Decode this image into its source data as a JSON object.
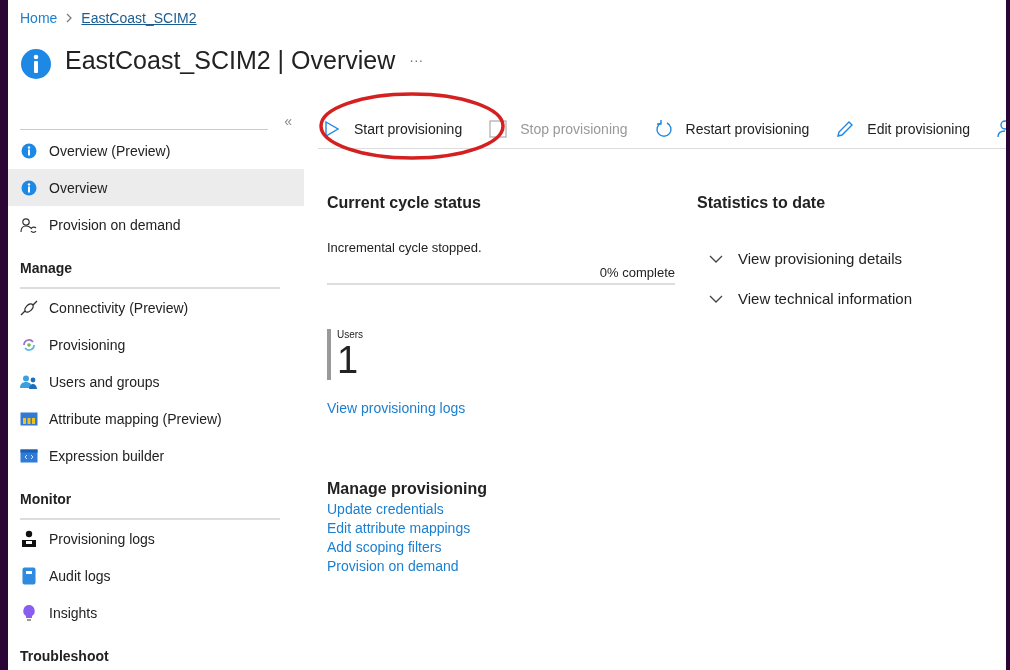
{
  "breadcrumb": [
    {
      "label": "Home",
      "current": false
    },
    {
      "label": "EastCoast_SCIM2",
      "current": true
    }
  ],
  "title": {
    "name": "EastCoast_SCIM2",
    "separator": "|",
    "page": "Overview",
    "more": "···"
  },
  "sidebar": {
    "collapse": "«",
    "sections": [
      {
        "items": [
          {
            "label": "Overview (Preview)",
            "kind": "info",
            "selected": false
          },
          {
            "label": "Overview",
            "kind": "info",
            "selected": true
          },
          {
            "label": "Provision on demand",
            "kind": "person-sync",
            "selected": false
          }
        ]
      },
      {
        "heading": "Manage",
        "items": [
          {
            "label": "Connectivity (Preview)",
            "kind": "plug",
            "selected": false
          },
          {
            "label": "Provisioning",
            "kind": "cycle",
            "selected": false
          },
          {
            "label": "Users and groups",
            "kind": "users",
            "selected": false
          },
          {
            "label": "Attribute mapping (Preview)",
            "kind": "table",
            "selected": false
          },
          {
            "label": "Expression builder",
            "kind": "code",
            "selected": false
          }
        ]
      },
      {
        "heading": "Monitor",
        "items": [
          {
            "label": "Provisioning logs",
            "kind": "person",
            "selected": false
          },
          {
            "label": "Audit logs",
            "kind": "book",
            "selected": false
          },
          {
            "label": "Insights",
            "kind": "bulb",
            "selected": false
          }
        ]
      },
      {
        "heading": "Troubleshoot"
      }
    ]
  },
  "toolbar": [
    {
      "label": "Start provisioning",
      "kind": "play",
      "disabled": false
    },
    {
      "label": "Stop provisioning",
      "kind": "stop",
      "disabled": true
    },
    {
      "label": "Restart provisioning",
      "kind": "restart",
      "disabled": false
    },
    {
      "label": "Edit provisioning",
      "kind": "edit",
      "disabled": false
    },
    {
      "kind": "person"
    }
  ],
  "current_cycle": {
    "heading": "Current cycle status",
    "status": "Incremental cycle stopped.",
    "progress_text": "0% complete",
    "level": 0,
    "stat": {
      "label": "Users",
      "value": "1"
    },
    "logs_link": "View provisioning logs"
  },
  "statistics": {
    "heading": "Statistics to date",
    "items": [
      {
        "label": "View provisioning details",
        "expanded": false
      },
      {
        "label": "View technical information",
        "expanded": false
      }
    ]
  },
  "manage_provisioning": {
    "heading": "Manage provisioning",
    "links": [
      "Update credentials",
      "Edit attribute mappings",
      "Add scoping filters",
      "Provision on demand"
    ]
  }
}
